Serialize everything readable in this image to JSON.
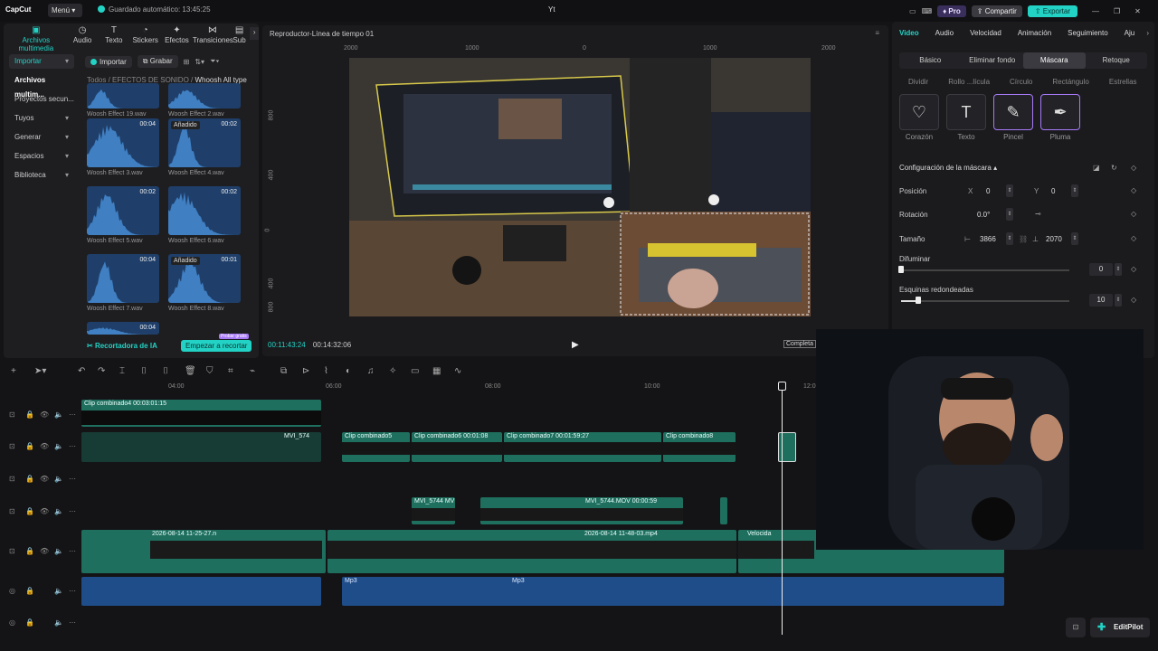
{
  "titlebar": {
    "logo": "CapCut",
    "menu": "Menú",
    "saved": "Guardado automático: 13:45:25",
    "window_title": "Yt",
    "pro": "Pro",
    "share": "Compartir",
    "export": "Exportar"
  },
  "categories": [
    {
      "label": "Archivos multimedia",
      "icon": "media-icon"
    },
    {
      "label": "Audio",
      "icon": "audio-icon"
    },
    {
      "label": "Texto",
      "icon": "text-icon"
    },
    {
      "label": "Stickers",
      "icon": "sticker-icon"
    },
    {
      "label": "Efectos",
      "icon": "effects-icon"
    },
    {
      "label": "Transiciones",
      "icon": "transitions-icon"
    },
    {
      "label": "Sub",
      "icon": "subtitles-icon"
    }
  ],
  "sidenav": {
    "import": "Importar",
    "media": "Archivos multim...",
    "projects": "Proyectos secun...",
    "yours": "Tuyos",
    "generate": "Generar",
    "spaces": "Espacios",
    "library": "Biblioteca"
  },
  "media": {
    "import_btn": "Importar",
    "record_btn": "Grabar",
    "crumb_all": "Todos",
    "crumb_sfx": "EFECTOS DE SONIDO",
    "crumb_current": "Whoosh All type"
  },
  "tiles": [
    {
      "name": "Woosh Effect 19.wav",
      "dur": "",
      "added": ""
    },
    {
      "name": "Woosh Effect 2.wav",
      "dur": "",
      "added": ""
    },
    {
      "name": "Woosh Effect 3.wav",
      "dur": "00:04",
      "added": ""
    },
    {
      "name": "Woosh Effect 4.wav",
      "dur": "00:02",
      "added": "Añadido"
    },
    {
      "name": "Woosh Effect 5.wav",
      "dur": "00:02",
      "added": ""
    },
    {
      "name": "Woosh Effect 6.wav",
      "dur": "00:02",
      "added": ""
    },
    {
      "name": "Woosh Effect 7.wav",
      "dur": "00:04",
      "added": ""
    },
    {
      "name": "Woosh Effect 8.wav",
      "dur": "00:01",
      "added": "Añadido"
    },
    {
      "name": "",
      "dur": "00:04",
      "added": ""
    }
  ],
  "ai": {
    "title": "Recortadora de IA",
    "button": "Empezar a recortar",
    "badge": "Probar gratis"
  },
  "player": {
    "title": "Reproductor-Línea de tiempo 01",
    "current": "00:11:43:24",
    "total": "00:14:32:06",
    "complete": "Completa",
    "ruler_h": [
      "2000",
      "1000",
      "0",
      "1000",
      "2000"
    ],
    "ruler_v": [
      "800",
      "400",
      "0",
      "400",
      "800"
    ]
  },
  "right": {
    "tabs": [
      "Video",
      "Audio",
      "Velocidad",
      "Animación",
      "Seguimiento",
      "Aju"
    ],
    "subtabs": [
      "Básico",
      "Eliminar fondo",
      "Máscara",
      "Retoque"
    ],
    "shape_names": [
      "Dividir",
      "Rollo ...lícula",
      "Círculo",
      "Rectángulo",
      "Estrellas"
    ],
    "shapes": [
      {
        "label": "Corazón",
        "glyph": "♡"
      },
      {
        "label": "Texto",
        "glyph": "T"
      },
      {
        "label": "Pincel",
        "glyph": "✎"
      },
      {
        "label": "Pluma",
        "glyph": "✒"
      }
    ],
    "config_title": "Configuración de la máscara",
    "position": "Posición",
    "x_label": "X",
    "x_val": "0",
    "y_label": "Y",
    "y_val": "0",
    "rotation": "Rotación",
    "rotation_val": "0.0°",
    "size": "Tamaño",
    "width": "3866",
    "height": "2070",
    "blur": "Difuminar",
    "blur_val": "0",
    "blur_level": 0,
    "corners": "Esquinas redondeadas",
    "corners_val": "10",
    "corners_level": 0.1
  },
  "timeline": {
    "times": [
      "04:00",
      "06:00",
      "08:00",
      "10:00",
      "12:0"
    ],
    "clips": [
      {
        "label": "Clip combinado4   00:03:01:15"
      },
      {
        "label": "MVI_574"
      },
      {
        "label": "Clip combinado5"
      },
      {
        "label": "Clip combinado6   00:01:08"
      },
      {
        "label": "Clip combinado7   00:01:59:27"
      },
      {
        "label": "Clip combinado8"
      },
      {
        "label": "MVI_5744 MV"
      },
      {
        "label": "MVI_5744.MOV   00:00:59"
      },
      {
        "label": "2026-08-14 11-25-27.n"
      },
      {
        "label": "2026-08-14 11-48-03.mp4"
      },
      {
        "label": "Velocida"
      },
      {
        "label": "Mp3"
      },
      {
        "label": "Mp3"
      }
    ]
  },
  "editpilot": "EditPilot"
}
